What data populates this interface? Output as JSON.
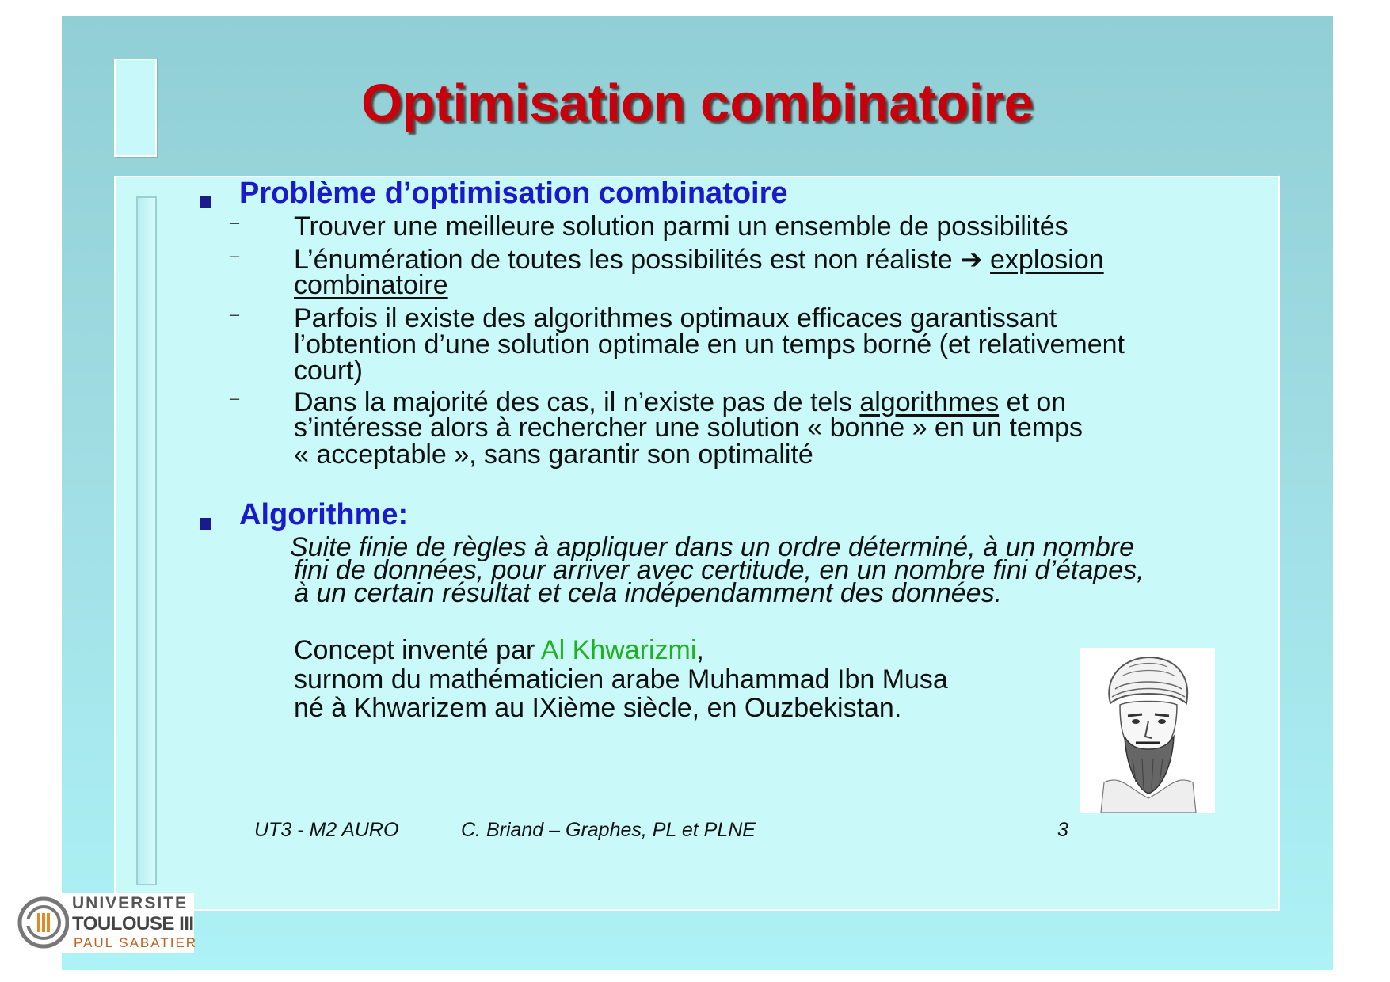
{
  "slide": {
    "title": "Optimisation combinatoire",
    "sections": [
      {
        "heading": "Problème d’optimisation combinatoire",
        "items": [
          {
            "lines": [
              "Trouver une meilleure solution parmi un ensemble de possibilités"
            ]
          },
          {
            "line1_text": "L’énumération de toutes les possibilités est non réaliste ",
            "arrow": "➔",
            "line1_link": "explosion",
            "line2_link": "combinatoire"
          },
          {
            "lines": [
              "Parfois il existe des algorithmes optimaux efficaces garantissant",
              "l’obtention d’une solution optimale en un temps borné (et relativement",
              "court)"
            ]
          },
          {
            "line1_pre": "Dans la majorité des cas, il n’existe pas de tels ",
            "line1_link": "algorithmes",
            "line1_post": " et on",
            "line2": "s’intéresse alors à rechercher une solution « bonne » en un temps",
            "line3": "« acceptable », sans garantir son optimalité"
          }
        ]
      },
      {
        "heading": "Algorithme:",
        "definition_lines": [
          "Suite finie de règles à appliquer dans un ordre déterminé, à un nombre",
          "fini de données, pour arriver avec certitude, en un nombre fini d’étapes,",
          "à un certain résultat et cela indépendamment des données."
        ],
        "concept_pre": "Concept inventé par ",
        "concept_name": "Al Khwarizmi",
        "concept_post": ",",
        "line2": "surnom du mathématicien arabe Muhammad Ibn Musa",
        "line3": " né à Khwarizem au  IXième  siècle, en Ouzbekistan."
      }
    ]
  },
  "footer": {
    "course": "UT3 - M2 AURO",
    "author": "C. Briand – Graphes, PL et PLNE",
    "page_number": "3"
  },
  "logo": {
    "line1": "UNIVERSITE",
    "line2": "TOULOUSE III",
    "line3": "PAUL SABATIER"
  },
  "colors": {
    "title": "#c8000c",
    "heading": "#1a1acb",
    "highlight": "#21b021",
    "background": "#9fdde3"
  }
}
